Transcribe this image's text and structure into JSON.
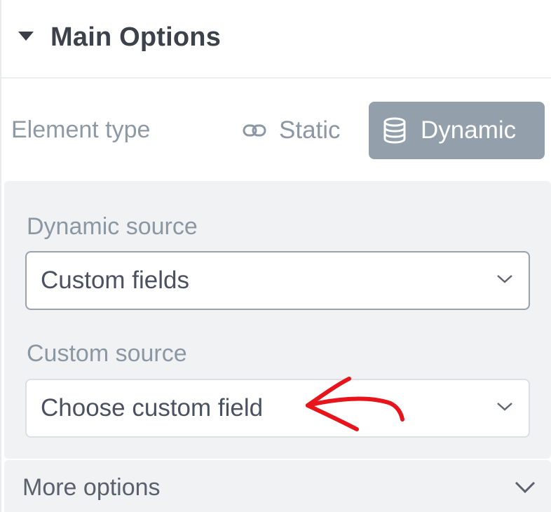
{
  "header": {
    "title": "Main Options"
  },
  "element_type": {
    "label": "Element type",
    "options": [
      {
        "label": "Static",
        "icon": "link-icon",
        "selected": false
      },
      {
        "label": "Dynamic",
        "icon": "database-icon",
        "selected": true
      }
    ]
  },
  "dynamic_source": {
    "label": "Dynamic source",
    "value": "Custom fields"
  },
  "custom_source": {
    "label": "Custom source",
    "placeholder": "Choose custom field"
  },
  "more_options": {
    "label": "More options"
  },
  "colors": {
    "selected_bg": "#93a0ab",
    "annotation_arrow": "#e8141c"
  }
}
